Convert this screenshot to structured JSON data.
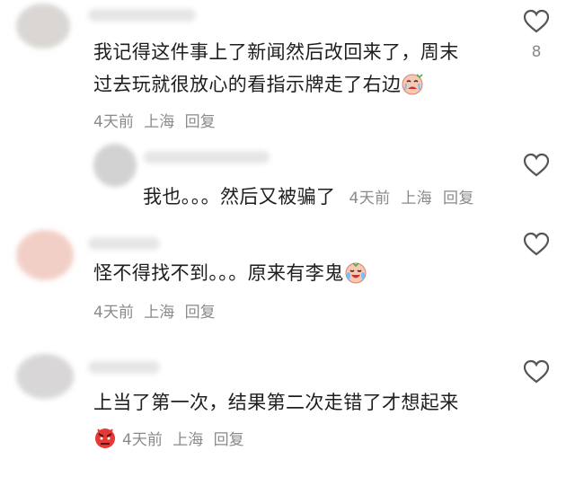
{
  "colors": {
    "text": "#1e1e1e",
    "meta": "#8a8a8a",
    "icon": "#555555"
  },
  "comments": [
    {
      "lines": [
        "我记得这件事上了新闻然后改回来了，周末",
        "过去玩就很放心的看指示牌走了右边"
      ],
      "emoji": "crying-face-emoji",
      "time": "4天前",
      "location": "上海",
      "reply": "回复",
      "likes": "8"
    },
    {
      "text": "我也。。。然后又被骗了",
      "time": "4天前",
      "location": "上海",
      "reply": "回复"
    },
    {
      "text": "怪不得找不到。。。原来有李鬼",
      "emoji": "laugh-cry-emoji",
      "time": "4天前",
      "location": "上海",
      "reply": "回复"
    },
    {
      "text": "上当了第一次，结果第二次走错了才想起来",
      "emoji": "angry-face-emoji",
      "time": "4天前",
      "location": "上海",
      "reply": "回复"
    }
  ]
}
